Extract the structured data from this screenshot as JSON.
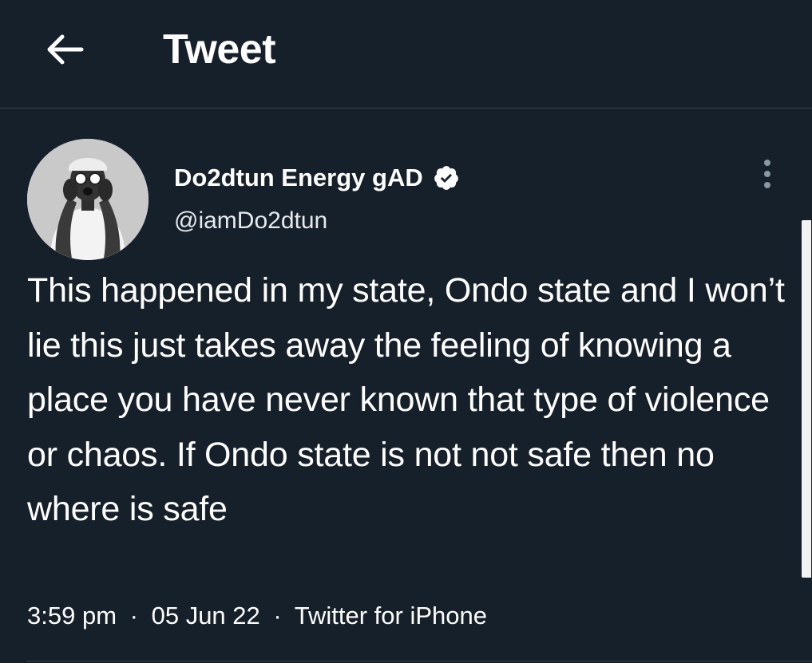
{
  "header": {
    "title": "Tweet",
    "back_icon": "arrow-left-icon"
  },
  "tweet": {
    "author": {
      "display_name": "Do2dtun Energy gAD",
      "handle": "@iamDo2dtun",
      "verified": true,
      "verified_icon": "verified-badge-icon"
    },
    "text": "This happened in my state, Ondo state and I won’t lie this just takes away the feeling of knowing a place you have never known that type of violence or chaos. If Ondo state is not not safe then no where is safe",
    "time": "3:59 pm",
    "date": "05 Jun 22",
    "source": "Twitter for iPhone",
    "separator": "·",
    "more_icon": "more-vertical-icon"
  },
  "colors": {
    "background": "#15202b",
    "divider": "#38444d",
    "text": "#ffffff",
    "verified_badge": "#ffffff"
  }
}
